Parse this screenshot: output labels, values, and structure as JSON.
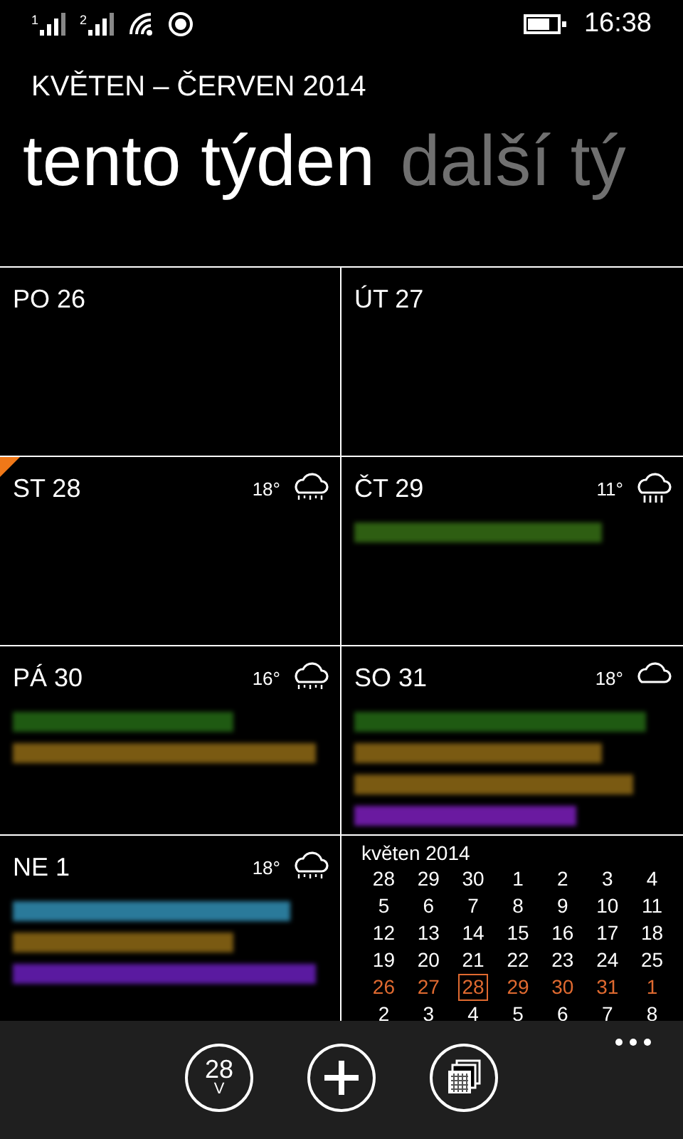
{
  "status_bar": {
    "sims": [
      "1",
      "2"
    ],
    "time": "16:38"
  },
  "header": {
    "title": "KVĚTEN – ČERVEN 2014",
    "pivots": [
      {
        "label": "tento týden",
        "selected": true
      },
      {
        "label": "další tý",
        "selected": false
      }
    ]
  },
  "days": [
    {
      "label": "PO 26",
      "today": false
    },
    {
      "label": "ÚT 27",
      "today": false
    },
    {
      "label": "ST 28",
      "today": true,
      "temperature": "18°",
      "weather": {
        "kind": "rain"
      }
    },
    {
      "label": "ČT 29",
      "today": false,
      "temperature": "11°",
      "weather": {
        "kind": "heavy-rain"
      },
      "events": [
        {
          "color": "#2e5e12"
        }
      ]
    },
    {
      "label": "PÁ 30",
      "today": false,
      "temperature": "16°",
      "weather": {
        "kind": "rain"
      },
      "events": [
        {
          "color": "#1f5a12"
        },
        {
          "color": "#7a5a12"
        }
      ]
    },
    {
      "label": "SO 31",
      "today": false,
      "temperature": "18°",
      "weather": {
        "kind": "cloud"
      },
      "events": [
        {
          "color": "#1f5a12"
        },
        {
          "color": "#7a5a12"
        },
        {
          "color": "#7a5a12"
        },
        {
          "color": "#6a1aa0"
        }
      ]
    },
    {
      "label": "NE 1",
      "today": false,
      "temperature": "18°",
      "weather": {
        "kind": "rain"
      },
      "events": [
        {
          "color": "#2a7a9a"
        },
        {
          "color": "#7a5a12"
        },
        {
          "color": "#5a1aa0"
        }
      ]
    }
  ],
  "mini_calendar": {
    "title": "květen 2014",
    "weeks": [
      {
        "current": false,
        "days": [
          {
            "label": "28",
            "selected": false
          },
          {
            "label": "29",
            "selected": false
          },
          {
            "label": "30",
            "selected": false
          },
          {
            "label": "1",
            "selected": false
          },
          {
            "label": "2",
            "selected": false
          },
          {
            "label": "3",
            "selected": false
          },
          {
            "label": "4",
            "selected": false
          }
        ]
      },
      {
        "current": false,
        "days": [
          {
            "label": "5",
            "selected": false
          },
          {
            "label": "6",
            "selected": false
          },
          {
            "label": "7",
            "selected": false
          },
          {
            "label": "8",
            "selected": false
          },
          {
            "label": "9",
            "selected": false
          },
          {
            "label": "10",
            "selected": false
          },
          {
            "label": "11",
            "selected": false
          }
        ]
      },
      {
        "current": false,
        "days": [
          {
            "label": "12",
            "selected": false
          },
          {
            "label": "13",
            "selected": false
          },
          {
            "label": "14",
            "selected": false
          },
          {
            "label": "15",
            "selected": false
          },
          {
            "label": "16",
            "selected": false
          },
          {
            "label": "17",
            "selected": false
          },
          {
            "label": "18",
            "selected": false
          }
        ]
      },
      {
        "current": false,
        "days": [
          {
            "label": "19",
            "selected": false
          },
          {
            "label": "20",
            "selected": false
          },
          {
            "label": "21",
            "selected": false
          },
          {
            "label": "22",
            "selected": false
          },
          {
            "label": "23",
            "selected": false
          },
          {
            "label": "24",
            "selected": false
          },
          {
            "label": "25",
            "selected": false
          }
        ]
      },
      {
        "current": true,
        "days": [
          {
            "label": "26",
            "selected": false
          },
          {
            "label": "27",
            "selected": false
          },
          {
            "label": "28",
            "selected": true
          },
          {
            "label": "29",
            "selected": false
          },
          {
            "label": "30",
            "selected": false
          },
          {
            "label": "31",
            "selected": false
          },
          {
            "label": "1",
            "selected": false
          }
        ]
      },
      {
        "current": false,
        "days": [
          {
            "label": "2",
            "selected": false
          },
          {
            "label": "3",
            "selected": false
          },
          {
            "label": "4",
            "selected": false
          },
          {
            "label": "5",
            "selected": false
          },
          {
            "label": "6",
            "selected": false
          },
          {
            "label": "7",
            "selected": false
          },
          {
            "label": "8",
            "selected": false
          }
        ]
      }
    ]
  },
  "app_bar": {
    "today_day": "28",
    "today_weekday": "V"
  }
}
